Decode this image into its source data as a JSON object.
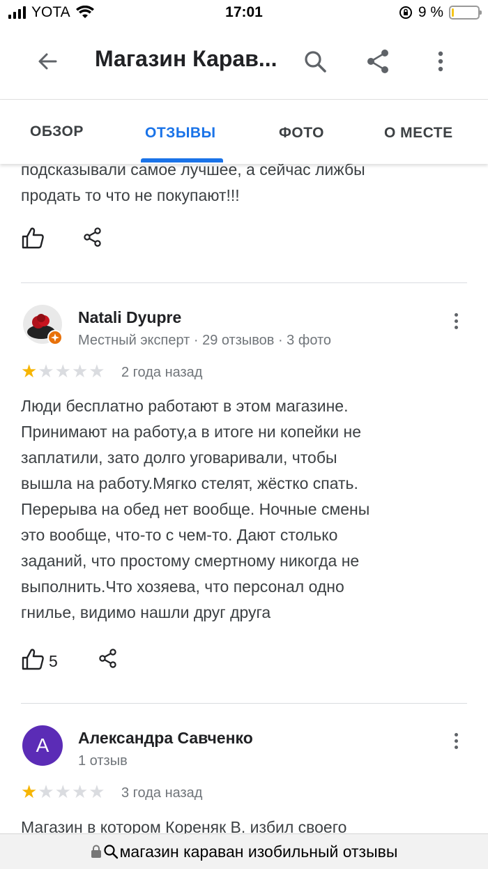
{
  "status_bar": {
    "carrier": "YOTA",
    "time": "17:01",
    "battery_percent_label": "9 %",
    "battery_level": 0.09
  },
  "app_bar": {
    "title": "Магазин Карав...",
    "icons": [
      "back-arrow-icon",
      "search-icon",
      "share-icon",
      "more-vert-icon"
    ]
  },
  "tabs": [
    {
      "label": "ОБЗОР",
      "active": false
    },
    {
      "label": "ОТЗЫВЫ",
      "active": true
    },
    {
      "label": "ФОТО",
      "active": false
    },
    {
      "label": "О МЕСТЕ",
      "active": false
    }
  ],
  "partial_review": {
    "text_lines": [
      "подсказывали самое лучшее, а сейчас  лижбы",
      "продать то что не покупают!!!"
    ]
  },
  "reviews": [
    {
      "author": "Natali Dyupre",
      "meta": "Местный эксперт · 29 отзывов · 3 фото",
      "rating": 1,
      "rating_max": 5,
      "time_ago": "2 года назад",
      "text_lines": [
        "Люди бесплатно работают в этом магазине.",
        "Принимают на работу,а в итоге ни копейки не",
        "заплатили, зато долго уговаривали, чтобы",
        "вышла на работу.Мягко стелят, жёстко спать.",
        "Перерыва на обед нет вообще. Ночные смены",
        "это вообще, что-то с чем-то. Дают столько",
        "заданий, что простому смертному никогда не",
        "выполнить.Что хозяева, что персонал одно",
        "гнилье, видимо нашли друг друга"
      ],
      "likes": "5"
    },
    {
      "author": "Александра Савченко",
      "avatar_letter": "А",
      "avatar_color": "#5b2cb6",
      "meta": "1 отзыв",
      "rating": 1,
      "rating_max": 5,
      "time_ago": "3 года назад",
      "text_lines": [
        "Магазин в котором Кореняк В. избил своего"
      ]
    }
  ],
  "browser_bar": {
    "url_text": "магазин караван изобильный отзывы"
  },
  "colors": {
    "accent": "#1a73e8",
    "star": "#f6b504",
    "star_off": "#dadce0"
  }
}
